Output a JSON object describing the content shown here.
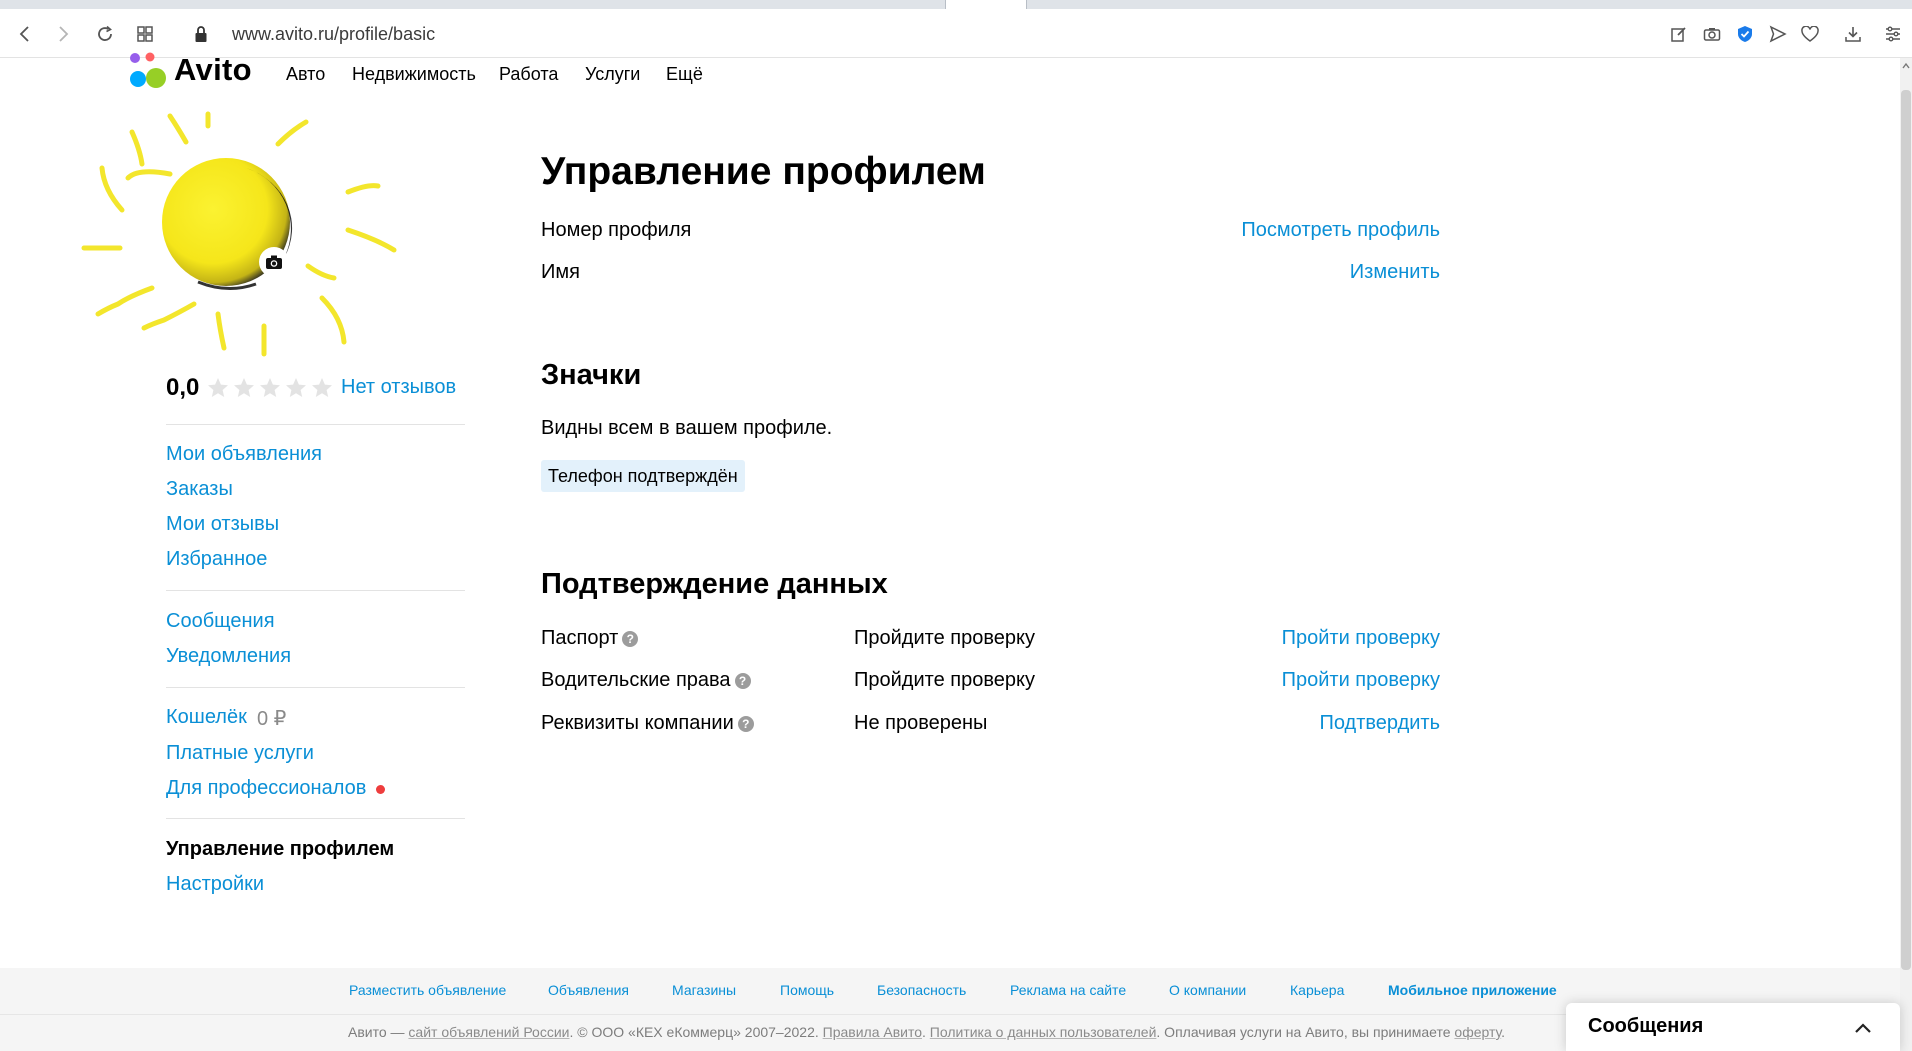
{
  "browser": {
    "url": "www.avito.ru/profile/basic"
  },
  "header": {
    "logo_text": "Avito",
    "nav": [
      "Авто",
      "Недвижимость",
      "Работа",
      "Услуги",
      "Ещё"
    ]
  },
  "profile": {
    "rating": "0,0",
    "stars_filled": 0,
    "stars_total": 5,
    "reviews_link": "Нет отзывов"
  },
  "sidebar": {
    "group1": [
      "Мои объявления",
      "Заказы",
      "Мои отзывы",
      "Избранное"
    ],
    "group2": [
      "Сообщения",
      "Уведомления"
    ],
    "group3": {
      "wallet": "Кошелёк",
      "wallet_amount": "0 ₽",
      "paid_services": "Платные услуги",
      "for_pros": "Для профессионалов"
    },
    "group4": {
      "active": "Управление профилем",
      "settings": "Настройки"
    }
  },
  "main": {
    "title": "Управление профилем",
    "rows": [
      {
        "label": "Номер профиля",
        "action": "Посмотреть профиль"
      },
      {
        "label": "Имя",
        "action": "Изменить"
      }
    ],
    "badges_title": "Значки",
    "badges_desc": "Видны всем в вашем профиле.",
    "badge": "Телефон подтверждён",
    "verify_title": "Подтверждение данных",
    "verify_rows": [
      {
        "label": "Паспорт",
        "status": "Пройдите проверку",
        "action": "Пройти проверку"
      },
      {
        "label": "Водительские права",
        "status": "Пройдите проверку",
        "action": "Пройти проверку"
      },
      {
        "label": "Реквизиты компании",
        "status": "Не проверены",
        "action": "Подтвердить"
      }
    ]
  },
  "footer": {
    "links": [
      "Разместить объявление",
      "Объявления",
      "Магазины",
      "Помощь",
      "Безопасность",
      "Реклама на сайте",
      "О компании",
      "Карьера"
    ],
    "app_link": "Мобильное приложение",
    "copy_1": "Авито — ",
    "copy_link1": "сайт объявлений России",
    "copy_2": ". © ООО «КЕХ еКоммерц» 2007–2022. ",
    "copy_link2": "Правила Авито",
    "copy_3": ". ",
    "copy_link3": "Политика о данных пользователей",
    "copy_4": ". Оплачивая услуги на Авито, вы принимаете ",
    "copy_link4": "оферту",
    "copy_5": "."
  },
  "messages_widget": {
    "title": "Сообщения"
  },
  "colors": {
    "link": "#0a8fd6",
    "badge_bg": "#e3f1fb",
    "notification_dot": "#ee3d3d",
    "avatar_sun": "#f7ea1c"
  }
}
